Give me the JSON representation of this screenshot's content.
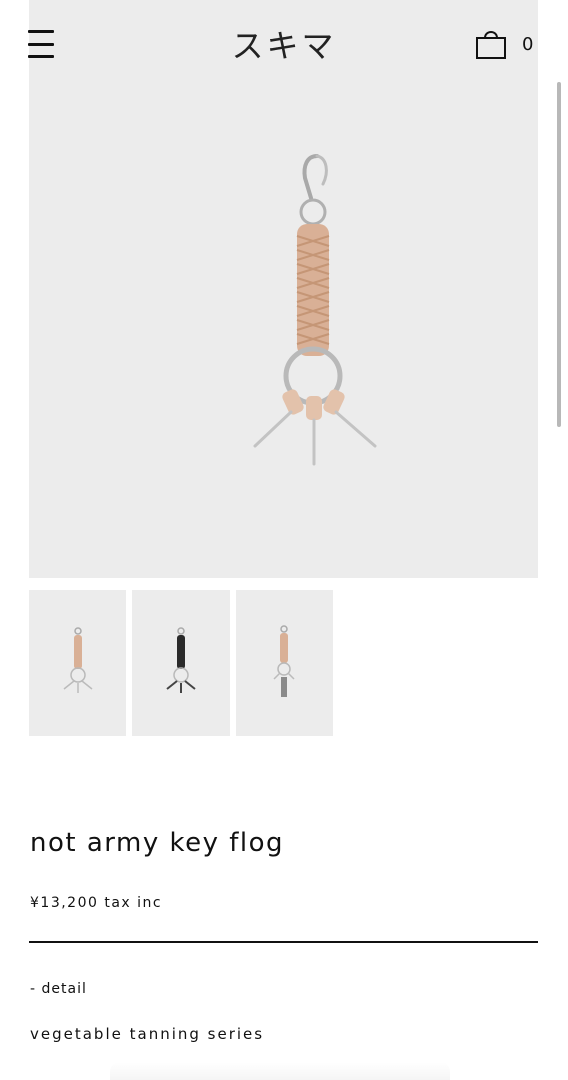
{
  "header": {
    "menu_icon": "hamburger-menu-icon",
    "logo_text": "スキマ",
    "cart_icon": "shopping-bag-icon",
    "cart_count": "0"
  },
  "hero": {
    "image": "product-photo-key-ring-natural-leather",
    "background_color": "#ececec"
  },
  "thumbnails": [
    {
      "variant": "natural-leather"
    },
    {
      "variant": "black-leather"
    },
    {
      "variant": "natural-leather-with-key"
    }
  ],
  "product": {
    "title": "not army key flog",
    "price": "¥13,200 tax inc",
    "detail_label": "- detail",
    "series": "vegetable tanning series"
  },
  "colors": {
    "leather_natural": "#d9b096",
    "leather_black": "#2a2a2a",
    "metal": "#b9b9b9"
  }
}
